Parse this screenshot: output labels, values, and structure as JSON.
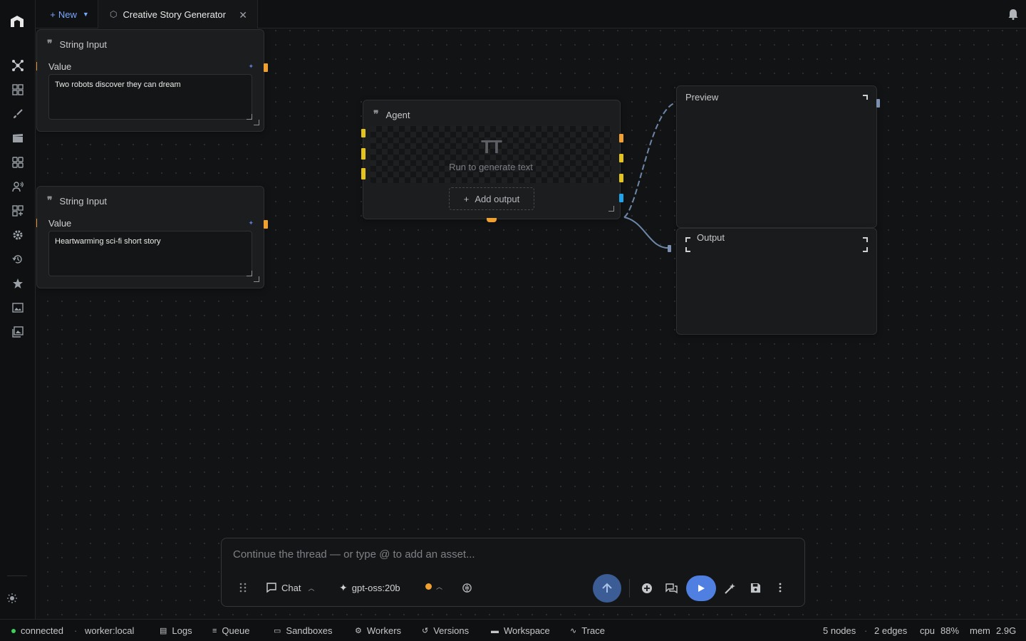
{
  "header": {
    "new_label": "New",
    "tab_title": "Creative Story Generator"
  },
  "nodes": {
    "string_input_1": {
      "title": "String Input",
      "field_label": "Value",
      "value": "Two robots discover they can dream"
    },
    "string_input_2": {
      "title": "String Input",
      "field_label": "Value",
      "value": "Heartwarming sci-fi short story"
    },
    "agent": {
      "title": "Agent",
      "placeholder": "Run to generate text",
      "add_output_label": "Add output"
    },
    "preview": {
      "title": "Preview"
    },
    "output": {
      "title": "Output"
    }
  },
  "chat": {
    "placeholder": "Continue the thread — or type @ to add an asset...",
    "mode_label": "Chat",
    "model_label": "gpt-oss:20b"
  },
  "status": {
    "connection": "connected",
    "worker": "worker:local",
    "items": [
      "Logs",
      "Queue",
      "Sandboxes",
      "Workers",
      "Versions",
      "Workspace",
      "Trace"
    ],
    "nodes": "5 nodes",
    "edges": "2 edges",
    "cpu_label": "cpu",
    "cpu_value": "88%",
    "mem_label": "mem",
    "mem_value": "2.9G"
  },
  "colors": {
    "accent": "#4f80e1",
    "port_orange": "#f0a030",
    "port_yellow": "#e5c31d",
    "port_blue": "#1fa3ea",
    "connected": "#3ecf5e"
  }
}
